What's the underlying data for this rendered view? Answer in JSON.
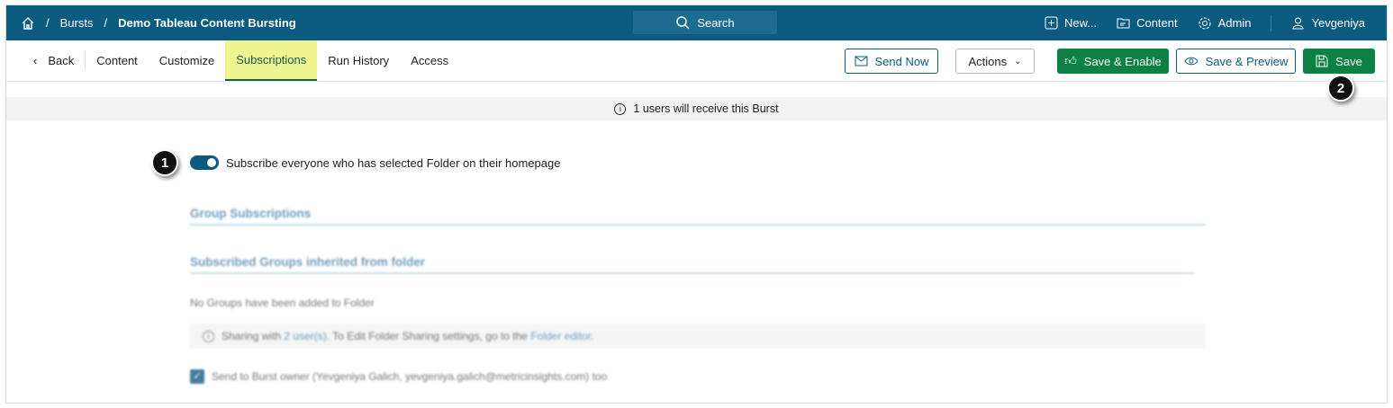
{
  "header": {
    "breadcrumb": [
      "Bursts",
      "Demo Tableau Content Bursting"
    ],
    "search_label": "Search",
    "nav": {
      "new": "New...",
      "content": "Content",
      "admin": "Admin",
      "user": "Yevgeniya"
    }
  },
  "tabs": {
    "back": "Back",
    "items": [
      "Content",
      "Customize",
      "Subscriptions",
      "Run History",
      "Access"
    ],
    "active": "Subscriptions"
  },
  "toolbar": {
    "send_now": "Send Now",
    "actions": "Actions",
    "save_enable": "Save & Enable",
    "save_preview": "Save & Preview",
    "save": "Save"
  },
  "info_bar": "1 users will receive this Burst",
  "callouts": [
    "1",
    "2"
  ],
  "subscribe_toggle": {
    "label": "Subscribe everyone who has selected Folder on their homepage",
    "on": true
  },
  "sections": {
    "group_subscriptions": "Group Subscriptions",
    "inherited": "Subscribed Groups inherited from folder",
    "no_groups": "No Groups have been added to Folder"
  },
  "sharing": {
    "prefix": "Sharing with",
    "users_link": "2 user(s)",
    "middle": ". To Edit Folder Sharing settings, go to the",
    "editor_link": "Folder editor",
    "suffix": "."
  },
  "owner_checkbox": {
    "label": "Send to Burst owner (Yevgeniya Galich, yevgeniya.galich@metricinsights.com) too",
    "checked": true
  },
  "colors": {
    "header": "#0b5b80",
    "green": "#0d8043",
    "active_tab": "#eef48e"
  }
}
